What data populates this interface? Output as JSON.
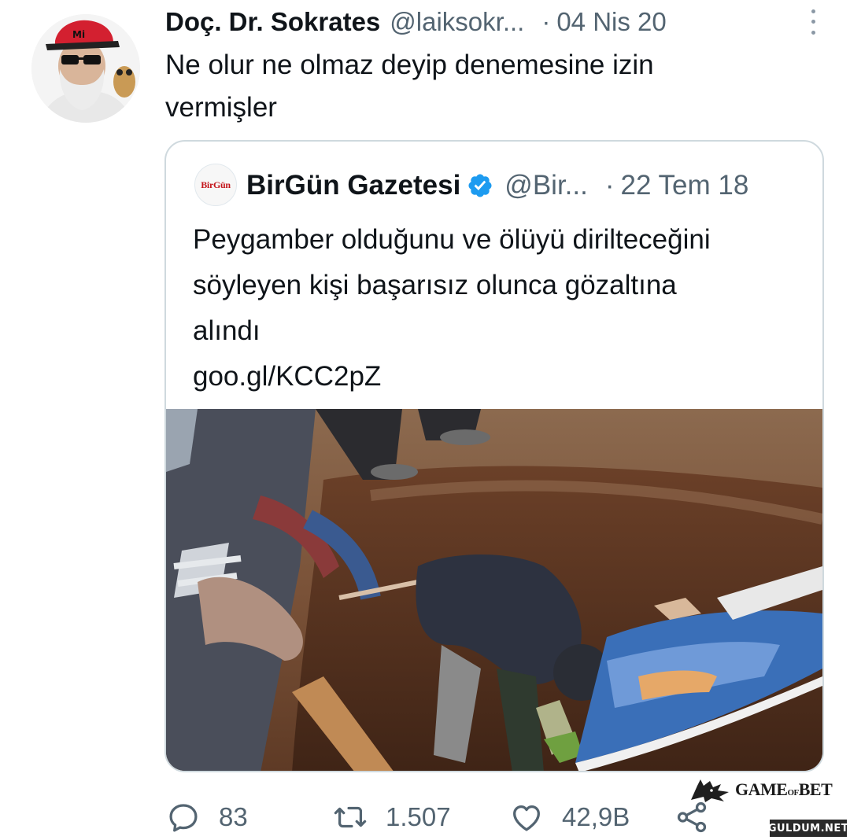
{
  "tweet": {
    "author_name": "Doç. Dr. Sokrates",
    "author_handle": "@laiksokr...",
    "separator": "·",
    "date": "04 Nis 20",
    "text_line1": "Ne olur ne olmaz deyip denemesine izin",
    "text_line2": "vermişler"
  },
  "quote": {
    "avatar_text": "BirGün",
    "author_name": "BirGün Gazetesi",
    "verified": true,
    "author_handle": "@Bir...",
    "separator": "·",
    "date": "22 Tem 18",
    "text_line1": "Peygamber olduğunu ve ölüyü dirilteceğini",
    "text_line2": "söyleyen kişi başarısız olunca gözaltına",
    "text_line3": "alındı",
    "link": "goo.gl/KCC2pZ"
  },
  "actions": {
    "reply_count": "83",
    "retweet_count": "1.507",
    "like_count": "42,9B"
  },
  "icons": {
    "reply": "reply-icon",
    "retweet": "retweet-icon",
    "like": "heart-icon",
    "share": "share-icon",
    "more": "more-icon",
    "verified": "verified-badge-icon"
  },
  "colors": {
    "verified_blue": "#1d9bf0",
    "secondary_text": "#536471",
    "border": "#cfd9de"
  },
  "watermark": {
    "brand": "GAME",
    "brand_of": "OF",
    "brand_end": "BET",
    "site": "GULDUM.NET"
  }
}
